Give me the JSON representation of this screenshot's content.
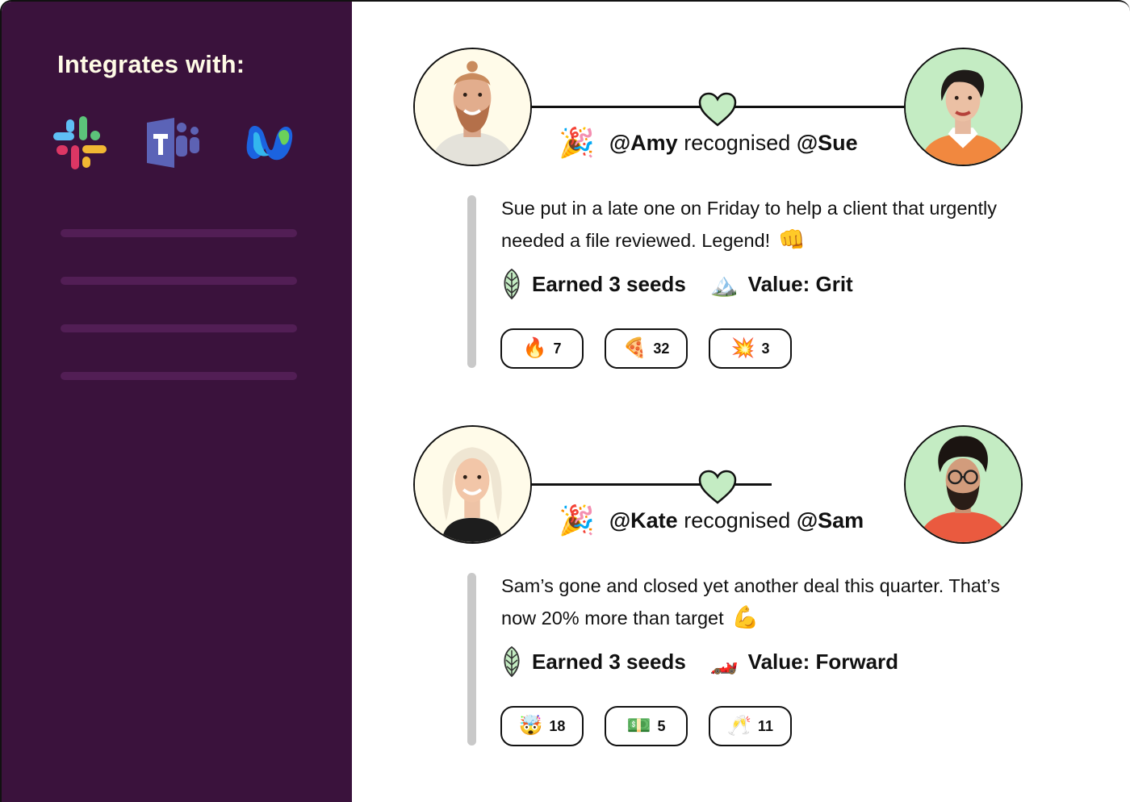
{
  "sidebar": {
    "title": "Integrates with:",
    "integrations": [
      {
        "name": "Slack",
        "icon": "slack-logo-icon"
      },
      {
        "name": "Microsoft Teams",
        "icon": "teams-logo-icon"
      },
      {
        "name": "Webex",
        "icon": "webex-logo-icon"
      }
    ],
    "colors": {
      "background": "#3a123c",
      "placeholder": "#521e55",
      "title": "#fffbe6"
    }
  },
  "feed": [
    {
      "giver": "@Amy",
      "verb": "recognised",
      "receiver": "@Sue",
      "party_emoji": "🎉",
      "message": "Sue put in a late one on Friday to help a client that urgently needed a file reviewed. Legend!",
      "message_emoji": "👊",
      "seeds_label": "Earned 3 seeds",
      "value_emoji": "🏔️",
      "value_label": "Value: Grit",
      "reactions": [
        {
          "emoji": "🔥",
          "count": "7"
        },
        {
          "emoji": "🍕",
          "count": "32"
        },
        {
          "emoji": "💥",
          "count": "3"
        }
      ]
    },
    {
      "giver": "@Kate",
      "verb": "recognised",
      "receiver": "@Sam",
      "party_emoji": "🎉",
      "message": "Sam’s gone and closed yet another deal this quarter. That’s now 20% more than target",
      "message_emoji": "💪",
      "seeds_label": "Earned 3 seeds",
      "value_emoji": "🏎️",
      "value_label": "Value: Forward",
      "reactions": [
        {
          "emoji": "🤯",
          "count": "18"
        },
        {
          "emoji": "💵",
          "count": "5"
        },
        {
          "emoji": "🥂",
          "count": "11"
        }
      ]
    }
  ],
  "colors": {
    "heart": "#c4ecc3",
    "avatar_left_bg": "#fffbe9",
    "avatar_right_bg": "#c4ecc3",
    "quote_bar": "#c9c9c9"
  }
}
